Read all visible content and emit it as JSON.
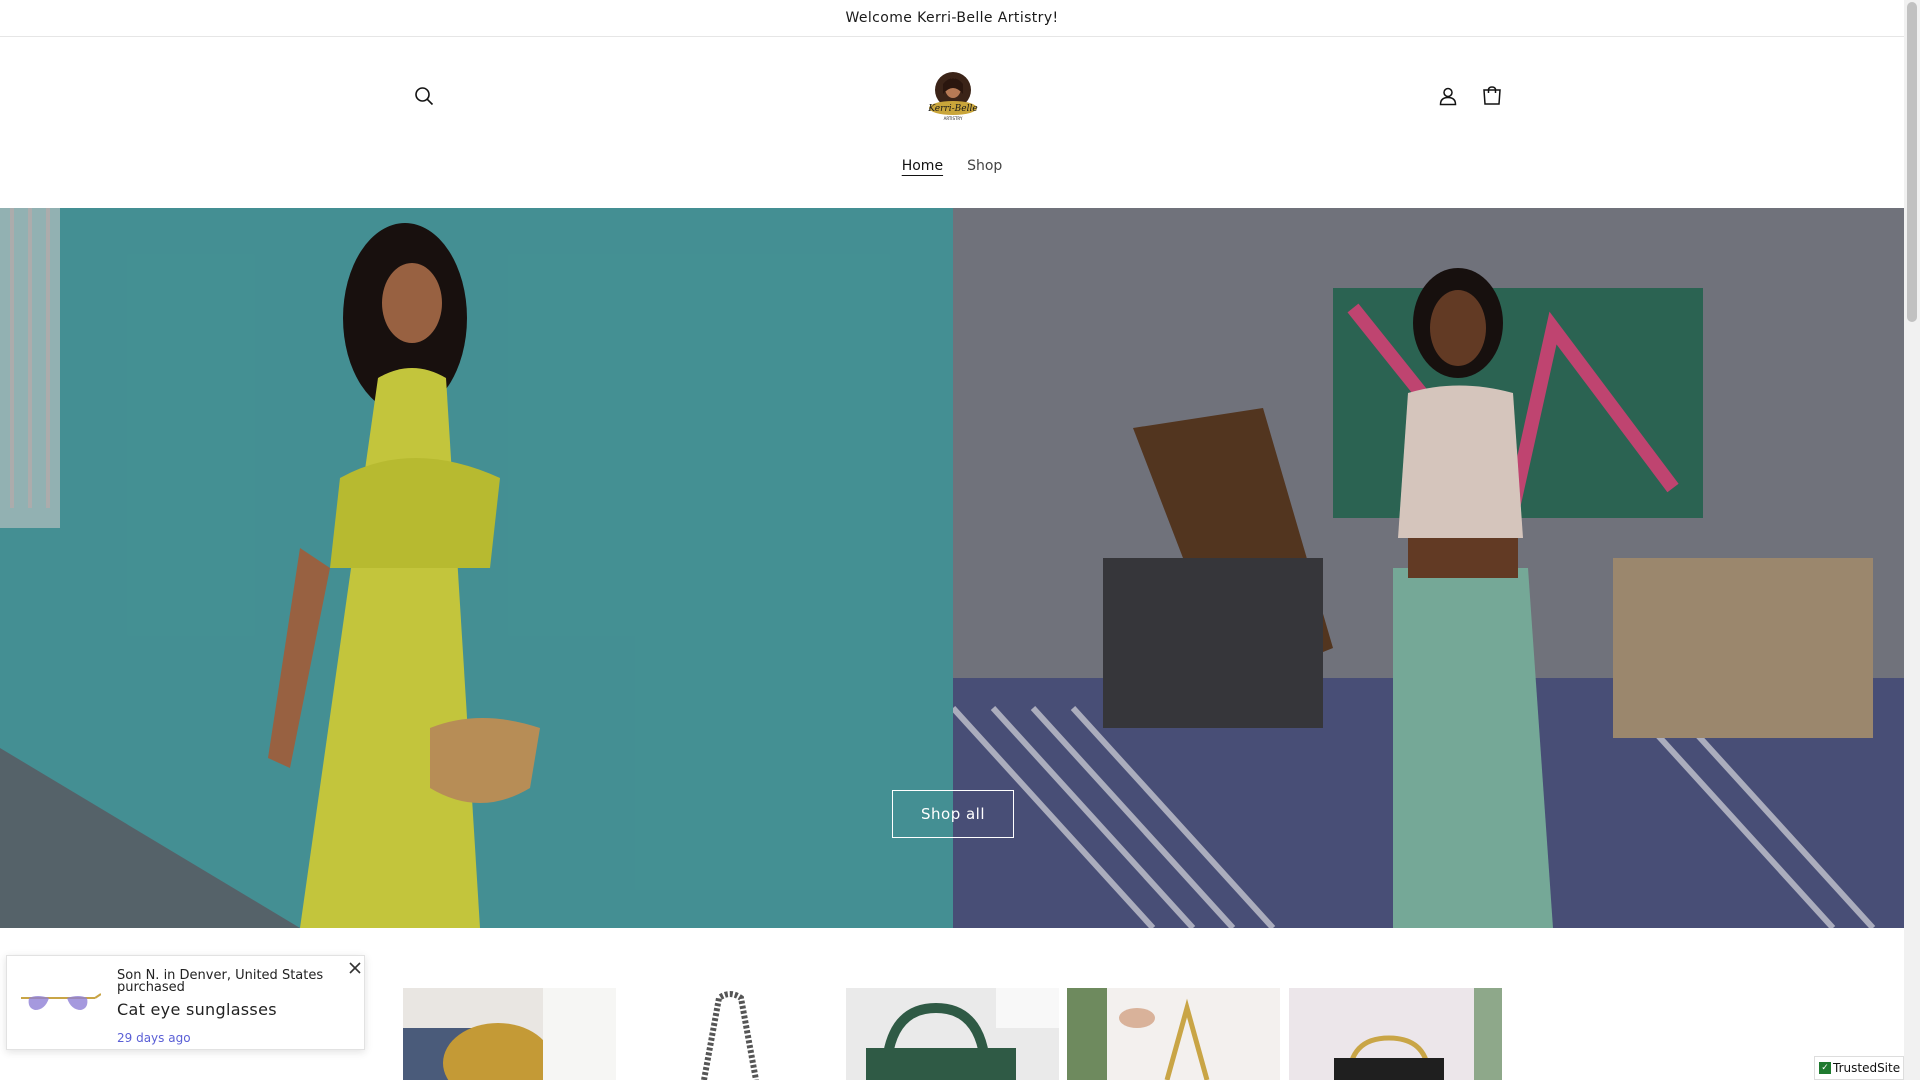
{
  "announcement": {
    "text": "Welcome Kerri-Belle Artistry!"
  },
  "header": {
    "logo_text": "Kerri-Belle",
    "logo_subtext": "ARTISTRY",
    "icons": {
      "search": "search-icon",
      "account": "account-icon",
      "cart": "cart-icon"
    }
  },
  "nav": {
    "items": [
      {
        "label": "Home",
        "active": true
      },
      {
        "label": "Shop",
        "active": false
      }
    ]
  },
  "hero": {
    "button_label": "Shop all"
  },
  "popup": {
    "who": "Son N. in Denver, United States purchased",
    "product": "Cat eye sunglasses",
    "time": "29 days ago"
  },
  "trusted": {
    "label": "TrustedSite"
  },
  "colors": {
    "accent": "#5a5fd6",
    "teal_wall": "#4f9ea2",
    "yellow_dress": "#d4d642",
    "green_pants": "#7fb7a4"
  }
}
